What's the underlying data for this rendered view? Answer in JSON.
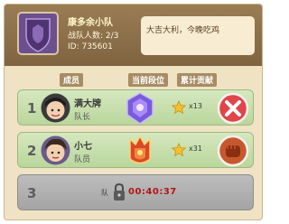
{
  "team": {
    "name": "康多余小队",
    "member_count": "战队人数: 2/3",
    "id": "ID: 735601",
    "motto": "大吉大利，今晚吃鸡"
  },
  "columns": {
    "member": "成员",
    "rank": "当前段位",
    "contribution": "累计贡献"
  },
  "members": [
    {
      "rank": "1",
      "name": "满大牌",
      "role": "队长",
      "contribution": "x13",
      "action_icon": "close-icon"
    },
    {
      "rank": "2",
      "name": "小七",
      "role": "队员",
      "contribution": "x31",
      "action_icon": "fist-icon"
    }
  ],
  "locked_slot": {
    "rank": "3",
    "label": "队",
    "timer": "00:40:37"
  },
  "colors": {
    "header_brown": "#8a6e4a",
    "panel_beige": "#efe3c4",
    "row_green": "#c6e0aa",
    "locked_gray": "#b0b0b0",
    "timer_red": "#b11616",
    "close_red": "#e0454a"
  }
}
